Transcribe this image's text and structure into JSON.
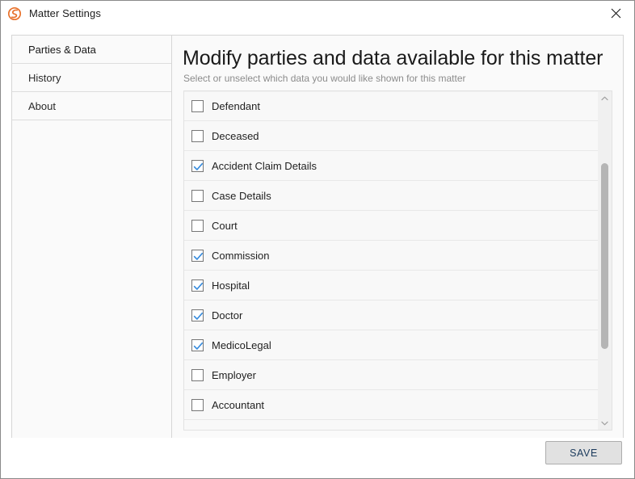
{
  "window": {
    "title": "Matter Settings",
    "app_icon": "swirl-logo-icon",
    "accent_color": "#e8722c",
    "close_label": "✕"
  },
  "sidebar": {
    "items": [
      {
        "label": "Parties & Data",
        "selected": true
      },
      {
        "label": "History",
        "selected": false
      },
      {
        "label": "About",
        "selected": false
      }
    ]
  },
  "main": {
    "heading": "Modify parties and data available for this matter",
    "subheading": "Select or unselect which data you would like shown for this matter",
    "list": [
      {
        "label": "Defendant",
        "checked": false
      },
      {
        "label": "Deceased",
        "checked": false
      },
      {
        "label": "Accident Claim Details",
        "checked": true
      },
      {
        "label": "Case Details",
        "checked": false
      },
      {
        "label": "Court",
        "checked": false
      },
      {
        "label": "Commission",
        "checked": true
      },
      {
        "label": "Hospital",
        "checked": true
      },
      {
        "label": "Doctor",
        "checked": true
      },
      {
        "label": "MedicoLegal",
        "checked": true
      },
      {
        "label": "Employer",
        "checked": false
      },
      {
        "label": "Accountant",
        "checked": false
      }
    ],
    "scrollbar": {
      "up_icon": "chevron-up-icon",
      "down_icon": "chevron-down-icon",
      "thumb_top_pct": 17,
      "thumb_height_pct": 56
    }
  },
  "footer": {
    "save_label": "SAVE"
  },
  "colors": {
    "checkbox_check": "#3a8ddd",
    "panel_bg": "#fafafa",
    "list_bg": "#f8f8f8",
    "border": "#d6d6d6"
  }
}
